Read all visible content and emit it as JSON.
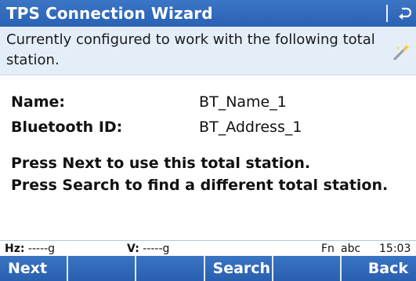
{
  "window": {
    "title": "TPS Connection Wizard"
  },
  "info": {
    "message": "Currently configured to work with the following total station."
  },
  "fields": [
    {
      "label": "Name:",
      "value": "BT_Name_1"
    },
    {
      "label": "Bluetooth ID:",
      "value": "BT_Address_1"
    }
  ],
  "instructions": [
    "Press Next to use this total station.",
    "Press Search to find a different total station."
  ],
  "status": {
    "hz_label": "Hz:",
    "hz_value": "-----g",
    "v_label": "V:",
    "v_value": "-----g",
    "fn": "Fn",
    "mode": "abc",
    "time": "15:03"
  },
  "softkeys": [
    "Next",
    "",
    "",
    "Search",
    "",
    "Back"
  ],
  "icons": {
    "return": "return-arrow-icon",
    "wizard": "magic-wand-icon"
  },
  "colors": {
    "title_bar": "#2f69ba",
    "info_bar": "#e4eef9",
    "softkey_bar": "#2f69ba"
  }
}
